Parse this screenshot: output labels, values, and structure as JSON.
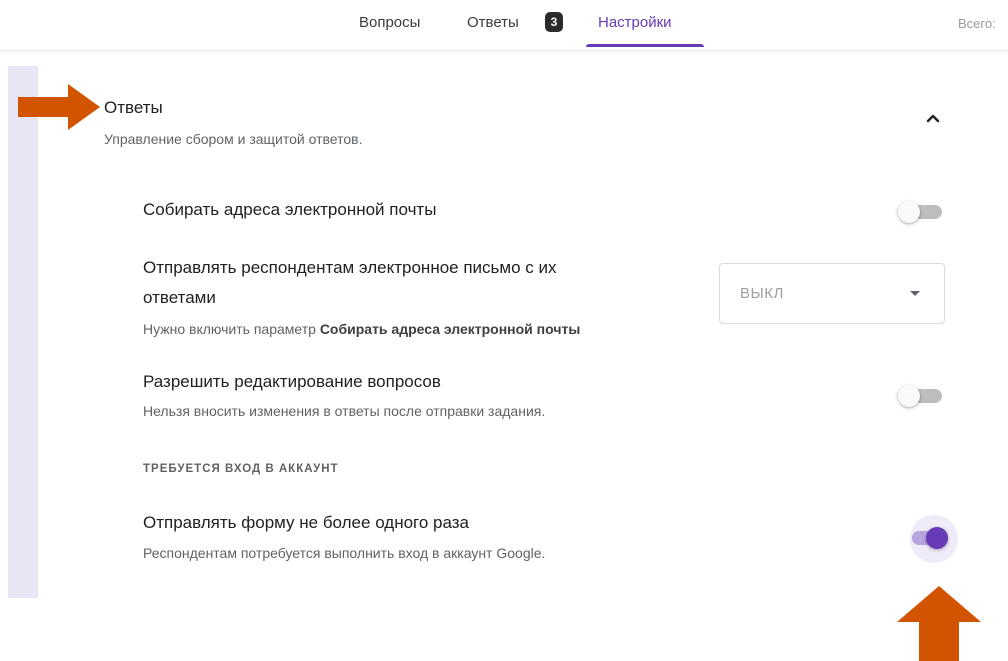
{
  "tabs": {
    "questions": "Вопросы",
    "responses": "Ответы",
    "responses_count": "3",
    "settings": "Настройки"
  },
  "total_label": "Всего:",
  "section": {
    "title": "Ответы",
    "subtitle": "Управление сбором и защитой ответов."
  },
  "settings": {
    "collect_email": {
      "title": "Собирать адреса электронной почты",
      "enabled": false
    },
    "send_copy": {
      "title_line1": "Отправлять респондентам электронное письмо с их",
      "title_line2": "ответами",
      "hint_prefix": "Нужно включить параметр",
      "hint_bold": "Собирать адреса электронной почты",
      "dropdown_value": "ВЫКЛ"
    },
    "allow_edit": {
      "title": "Разрешить редактирование вопросов",
      "subtitle": "Нельзя вносить изменения в ответы после отправки задания.",
      "enabled": false
    },
    "login_required_header": "ТРЕБУЕТСЯ ВХОД В АККАУНТ",
    "limit_one": {
      "title": "Отправлять форму не более одного раза",
      "subtitle": "Респондентам потребуется выполнить вход в аккаунт Google.",
      "enabled": true
    }
  },
  "colors": {
    "accent": "#673ab7",
    "annotation_arrow": "#d35400"
  }
}
